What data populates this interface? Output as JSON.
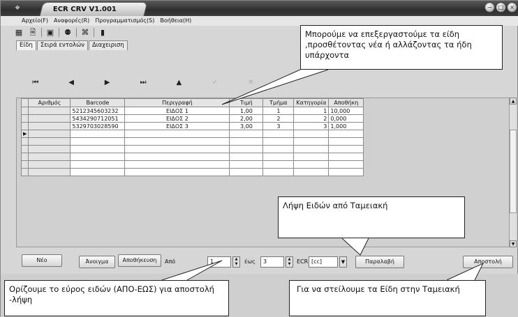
{
  "window": {
    "title": "ECR CRV V1.001",
    "icon": "⌖"
  },
  "window_buttons": [
    "−",
    "□",
    "×"
  ],
  "menu": [
    "Αρχείο(F)",
    "Αναφορές(R)",
    "Προγραμματισμός(S)",
    "Βοήθεια(H)"
  ],
  "toolbar_icons": [
    "grid-icon",
    "document-icon",
    "monitor-icon",
    "users-icon",
    "network-icon",
    "book-icon"
  ],
  "tabs": [
    "Είδη",
    "Σειρά εντολών",
    "Διαχειριση"
  ],
  "nav": {
    "first": "⏮",
    "prev": "◀",
    "next": "▶",
    "last": "⏭",
    "up": "▲",
    "confirm": "✓",
    "cancel": "✕"
  },
  "grid": {
    "headers": [
      "Αριθμός",
      "Barcode",
      "Περιγραφή",
      "Τιμή",
      "Τμήμα",
      "Κατηγορία",
      "Αποθήκη"
    ],
    "rows": [
      {
        "num": "",
        "barcode": "5212345603232",
        "desc": "ΕΙΔΟΣ 1",
        "price": "1,00",
        "dept": "1",
        "cat": "1",
        "stock": "10,000"
      },
      {
        "num": "",
        "barcode": "5434290712051",
        "desc": "ΕΙΔΟΣ 2",
        "price": "2,00",
        "dept": "2",
        "cat": "2",
        "stock": "0,000"
      },
      {
        "num": "",
        "barcode": "5329703028590",
        "desc": "ΕΙΔΟΣ 3",
        "price": "3,00",
        "dept": "3",
        "cat": "3",
        "stock": "1,000"
      }
    ],
    "current_row_marker": "▶"
  },
  "bottom": {
    "new": "Νέο",
    "open": "Άνοιγμα",
    "save": "Αποθήκευση",
    "from_label": "Από",
    "from_value": "1",
    "to_label": "έως",
    "to_value": "3",
    "ecr_label": "ECR",
    "ecr_value": "[cc]",
    "receive": "Παραλαβή",
    "send": "Αποστολή"
  },
  "callouts": {
    "top": "Μπορούμε να επεξεργαστούμε τα είδη ,προσθέτοντας νέα ή αλλάζοντας τα ήδη υπάρχοντα",
    "receive": "Λήψη Ειδών από Ταμειακή",
    "range": "Ορίζουμε το εύρος ειδών (ΑΠΟ-ΕΩΣ) για αποστολή -λήψη",
    "send": "Για να στείλουμε τα  Είδη στην Ταμειακή"
  }
}
